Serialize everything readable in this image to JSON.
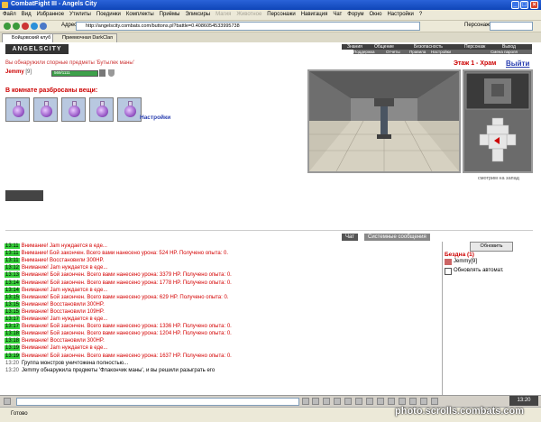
{
  "window": {
    "title": "CombatFight III - Angels City"
  },
  "menubar": [
    "Файл",
    "Вид",
    "Избранное",
    "Утилиты",
    "Поединки",
    "Комплекты",
    "Приёмы",
    "Эликсиры",
    "Магия",
    "Животное",
    "Персонажи",
    "Навигация",
    "Чат",
    "Форум",
    "Окно",
    "Настройки",
    "?"
  ],
  "menubar_disabled": [
    "Магия",
    "Животное"
  ],
  "address": {
    "label": "Адрес",
    "value": "http://angelscity.combats.com/buttons.pl?battle=0.4086054533995738",
    "persons_label": "Персонаж"
  },
  "browser_tabs": [
    "Бойцовский клуб",
    "Приемочная DarkClan"
  ],
  "game": {
    "logo": "ANGELSCITY",
    "topnav_main": [
      "Знания",
      "Общение",
      "Безопасность",
      "Персонаж",
      "Выход"
    ],
    "topnav_sub": [
      "Поддержка",
      "Отчеты",
      "Правила",
      "Настройки",
      "Смена пароля"
    ],
    "found_message": "Вы обнаружили спорные предметы 'Бутылек маны'",
    "floor": "Этаж 1 - Храм",
    "exit": "Выйти",
    "player": {
      "name": "Jemmy",
      "level": "[9]",
      "hp": "569/1111"
    },
    "room_items_title": "В комнате разбросаны вещи:",
    "items_count": 5,
    "settings_link": "Настройки",
    "view_direction": "смотрим на запад"
  },
  "chat": {
    "tabs": [
      "Чат",
      "Системные сообщения"
    ],
    "lines": [
      {
        "time": "13:11",
        "warn": true,
        "text": "Внимание! Jam нуждается в еде..."
      },
      {
        "time": "13:11",
        "warn": true,
        "text": "Внимание! Бой закончен. Всего вами нанесено урона: 524 HP. Получено опыта: 0."
      },
      {
        "time": "13:11",
        "warn": true,
        "text": "Внимание! Восстановили 300HP."
      },
      {
        "time": "13:12",
        "warn": true,
        "text": "Внимание! Jam нуждается в еде..."
      },
      {
        "time": "13:13",
        "warn": true,
        "text": "Внимание! Бой закончен. Всего вами нанесено урона: 3379 HP. Получено опыта: 0."
      },
      {
        "time": "13:14",
        "warn": true,
        "text": "Внимание! Бой закончен. Всего вами нанесено урона: 1778 HP. Получено опыта: 0."
      },
      {
        "time": "13:14",
        "warn": true,
        "text": "Внимание! Jam нуждается в еде..."
      },
      {
        "time": "13:15",
        "warn": true,
        "text": "Внимание! Бой закончен. Всего вами нанесено урона: 629 HP. Получено опыта: 0."
      },
      {
        "time": "13:15",
        "warn": true,
        "text": "Внимание! Восстановили 300HP."
      },
      {
        "time": "13:15",
        "warn": true,
        "text": "Внимание! Восстановили 109HP."
      },
      {
        "time": "13:17",
        "warn": true,
        "text": "Внимание! Jam нуждается в еде..."
      },
      {
        "time": "13:17",
        "warn": true,
        "text": "Внимание! Бой закончен. Всего вами нанесено урона: 1336 HP. Получено опыта: 0."
      },
      {
        "time": "13:18",
        "warn": true,
        "text": "Внимание! Бой закончен. Всего вами нанесено урона: 1204 HP. Получено опыта: 0."
      },
      {
        "time": "13:18",
        "warn": true,
        "text": "Внимание! Восстановили 300HP."
      },
      {
        "time": "13:19",
        "warn": true,
        "text": "Внимание! Jam нуждается в еде..."
      },
      {
        "time": "13:19",
        "warn": true,
        "text": "Внимание! Бой закончен. Всего вами нанесено урона: 1637 HP. Получено опыта: 0."
      },
      {
        "time": "13:20",
        "warn": false,
        "text": "Группа монстров уничтожена полностью..."
      },
      {
        "time": "13:20",
        "warn": false,
        "text": "Jemmy обнаружила предметы 'Флакончик маны', и вы решили разыграть его"
      }
    ]
  },
  "side": {
    "refresh": "Обновить",
    "location": "Бездна (1)",
    "player": "Jemmy[9]",
    "auto_refresh": "Обновлять автомат."
  },
  "clock": "13:20",
  "status": "Готово",
  "watermark": "photo.scrolls.combats.com",
  "colors": {
    "title_bar": "#1f55c8",
    "timestamp_bg": "#39d43d",
    "warning": "#d40000",
    "floor": "#c00000"
  }
}
